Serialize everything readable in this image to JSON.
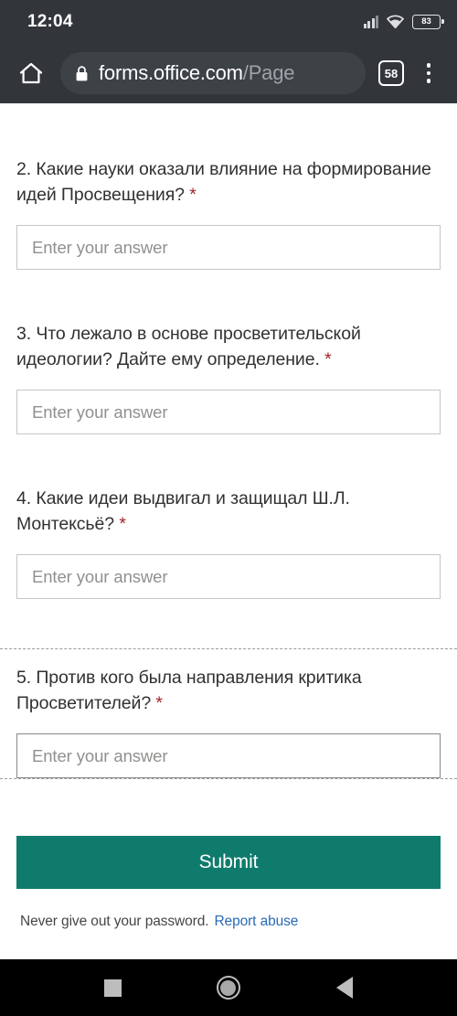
{
  "status_bar": {
    "clock": "12:04",
    "signal_icon": "cellular-signal-icon",
    "wifi_icon": "wifi-icon",
    "battery_icon": "battery-icon",
    "battery_level": "83"
  },
  "browser": {
    "home_icon": "home-icon",
    "lock_icon": "lock-icon",
    "url_domain": "forms.office.com",
    "url_path": "/Page",
    "tab_count": "58",
    "menu_icon": "overflow-menu-icon"
  },
  "form": {
    "questions": [
      {
        "text": "2. Какие науки оказали влияние на формирование идей Просвещения?",
        "required_marker": "*",
        "answer_value": "",
        "answer_placeholder": "Enter your answer",
        "focused": false
      },
      {
        "text": "3. Что лежало в основе просветительской идеологии? Дайте ему определение.",
        "required_marker": "*",
        "answer_value": "",
        "answer_placeholder": "Enter your answer",
        "focused": false
      },
      {
        "text": "4. Какие идеи выдвигал и защищал Ш.Л. Монтексьё?",
        "required_marker": "*",
        "answer_value": "",
        "answer_placeholder": "Enter your answer",
        "focused": false
      },
      {
        "text": "5. Против кого была направления критика Просветителей?",
        "required_marker": "*",
        "answer_value": "",
        "answer_placeholder": "Enter your answer",
        "focused": true
      }
    ],
    "submit_label": "Submit",
    "footer_text": "Never give out your password.",
    "report_abuse_label": "Report abuse"
  },
  "nav_bar": {
    "recents_icon": "square-recents-icon",
    "home_icon": "circle-home-icon",
    "back_icon": "triangle-back-icon"
  },
  "colors": {
    "chrome": "#32363b",
    "url_pill": "#3d4247",
    "submit_green": "#0f7b6c",
    "required_red": "#a4262c",
    "link_blue": "#2a6ab5",
    "nav_bar": "#000000"
  }
}
